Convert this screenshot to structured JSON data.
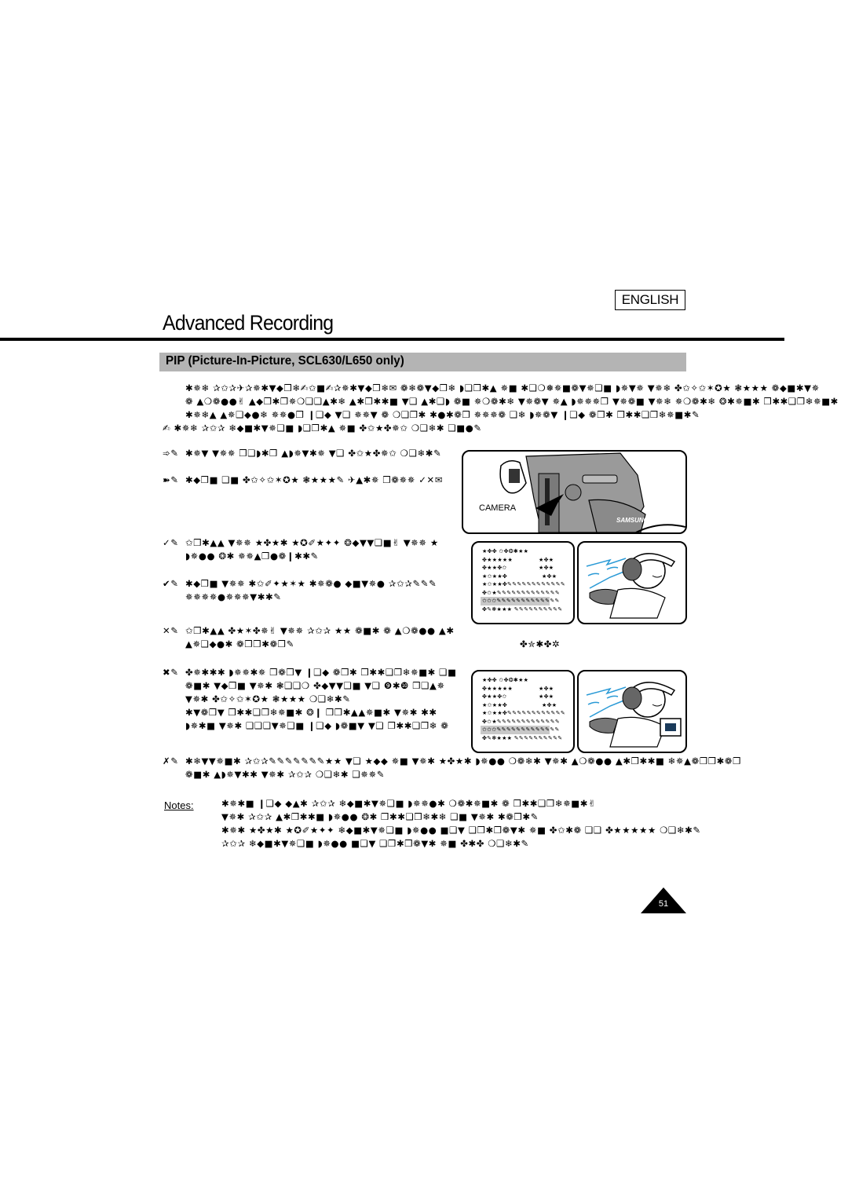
{
  "header": {
    "language_badge": "ENGLISH",
    "page_title": "Advanced Recording",
    "section_title": "PIP (Picture-In-Picture, SCL630/L650 only)"
  },
  "intro": {
    "lines": [
      "✱✵❄ ✰✩✰✈✰✵✱▼◆❒❄✍✩■✍✰✵✱▼◆❒❄✉ ❁❄❁▼◆❒❄ ◗❑❒✱▲ ✵■ ✱❑❍❅✵■❁▼✵❑■ ◗✵▼✵ ▼✵❄ ✤✩✧✩✶✪★ ❃★★★ ❁◆■✱▼✵",
      "❁ ▲❍❁●●✌ ▲◆❒✱❒✵❍❑❑▲✱❄ ▲✱❒✱✱■ ▼❑ ▲✱❑◗ ❁■ ✵❍❁✱❄ ▼✵❁▼ ✵▲ ◗✵✵✵❒ ▼✵❁■ ▼✵❄ ✵❍❁✱❄ ❂✱✵■✱ ❒✱✱❑❒❄✵■✱",
      "✱✵❄▲ ▲✵❑◆●❄ ✵✵●❒ ❙❑◆ ▼❑ ✵✵▼ ❁ ❍❑❒✱ ✱●✱❁❒ ✵✵✵❁ ❑❄ ◗✵❁▼ ❙❑◆ ❁❒✱ ❒✱✱❑❒❄✵■✱✎",
      "✍    ✱✵❄ ✰✩✰ ❄◆■✱▼✵❑■ ◗❑❒✱▲ ✵■ ✤✩★✤✵✩ ❍❑❄✱ ❑■●✎"
    ]
  },
  "steps": [
    {
      "marker": "➾✎",
      "lines": [
        "✱✵▼ ▼✵✵ ❒❑◗✱❒ ▲◗✵▼✱✵ ▼❑ ✤✩★✤✵✩ ❍❑❄✱✎"
      ]
    },
    {
      "marker": "➽✎",
      "lines": [
        "✱◆❒■ ❑■ ✤✩✧✩✶✪★ ❃★★★✎ ✈▲✱✵ ❒❁✵✵ ✓✕✉"
      ]
    },
    {
      "marker": "✓✎",
      "lines": [
        "✩❒✱▲▲ ▼✵✵ ★✤★✱ ★✪✐★✦✦ ❂◆▼▼❑■✌ ▼✵✵ ★",
        "◗✵●● ❂✱ ✵✵▲❒●❁❙✱✱✎"
      ]
    },
    {
      "marker": "✔✎",
      "lines": [
        "✱◆❒■ ▼✵✵ ✱✩✐✦★✶★ ✱✵❁● ◆■▼✵● ✰✩✰✎✎✎",
        "✵✵✵✵●✵✵✵▼✱✱✎"
      ]
    },
    {
      "marker": "✕✎",
      "lines": [
        "✩❒✱▲▲ ✤★✶✤✵✌ ▼✵✵ ✰✩✰ ★★ ❁■✱ ❁ ▲❍❁●● ▲✱",
        "▲✵❑◆●✱ ❁❒❒✱❁❒✎"
      ]
    },
    {
      "marker": "✖✎",
      "lines": [
        "✤✵✱✱✱ ◗✵✵✱✵ ❒❁❒▼ ❙❑◆ ❁❒✱ ❒✱✱❑❒❄✵■✱ ❑■",
        "❁■✱ ▼◆❒■ ▼✵✱ ❃❑❑❍ ✤◆▼▼❑■ ▼❑ ❾✱❿ ❒❑▲✵",
        "▼✵✱ ✤✩✧✩✶✪★ ❃★★★ ❍❑❄✱✎",
        "    ✱▼❁❒▼ ❒✱✱❑❒❄✵■✱ ❂❙ ❒❒✱▲▲✵■✱ ▼✵✱ ✱✱",
        "    ◗✵✱■ ▼✵✱ ❑❑❑▼✵❑■ ❙❑◆ ◗❁■▼ ▼❑ ❒✱✱❑❒❄ ❁"
      ]
    },
    {
      "marker": "✗✎",
      "lines": [
        "✱❄▼▼✵■✱ ✰✩✰✎✎✎✎✎✎✎★★ ▼❑ ★◆◆ ✵■ ▼✵✱ ★✤★✱ ◗✵●● ❍❁❄✱ ▼✵✱ ▲❍❁●● ▲✱❒✱✱■ ❄✵▲❁❒❒✱❁❒",
        "❁■✱ ▲◗✵▼✱✱ ▼✵✱ ✰✩✰ ❍❑❄✱ ❑✵✵✎"
      ]
    }
  ],
  "camera_illustration": {
    "label": "CAMERA",
    "brand": "SAMSUNG"
  },
  "menu_screen": {
    "rows": [
      {
        "left": "★✤✤ ✩✤❂✱★★",
        "right": ""
      },
      {
        "left": "✤★★★★★",
        "right": "★✤★"
      },
      {
        "left": "✤★★✤✩",
        "right": "★✤★"
      },
      {
        "left": "★✩★★✤",
        "right": "★✤★"
      },
      {
        "left": "★✩★★✤✎✎✎✎✎✎✎✎✎✎✎✎",
        "right": ""
      },
      {
        "left": "✤✩★✎✎✎✎✎✎✎✎✎✎✎✎✎",
        "right": ""
      },
      {
        "left": "✩✩✩✎✎✎✎✎✎✎✎✎✎✎✎✎",
        "right": "",
        "highlighted": true
      },
      {
        "left": "✤✎❃★★★ ✎✎✎✎✎✎✎✎✎✎",
        "right": ""
      }
    ]
  },
  "step5_tail": "✤✮✱✤✲",
  "notes": {
    "label": "Notes:",
    "lines": [
      "✱✵✱■ ❙❑◆ ◆▲✱ ✰✩✰ ❄◆■✱▼✵❑■ ◗✵✵●✱ ❍❁✱✵■✱ ❁ ❒✱✱❑❒❄✵■✱✌",
      "▼✵✱ ✰✩✰ ▲✱❒✱✱■ ◗✵●● ❂✱ ❒✱✱❑❒❄✱❄ ❑■ ▼✵✱ ✱❁❒✱✎",
      "✱✵✱ ★✤★✱ ★✪✐★✦✦ ❄◆■✱▼✵❑■ ◗✵●● ■❑▼ ❑❒✱❒❁▼✱ ✵■ ✤✩✱❁ ❑❑ ✤★★★★★ ❍❑❄✱✎",
      "✰✩✰ ❄◆■✱▼✵❑■ ◗✵●● ■❑▼ ❑❒✱❒❁▼✱ ✵■ ✤✱✤ ❍❑❄✱✎"
    ]
  },
  "footer": {
    "page_number": "51"
  },
  "colors": {
    "section_bar": "#b4b4b4",
    "menu_highlight": "#c8c8c8",
    "wind_lines": "#2a9ad6"
  }
}
